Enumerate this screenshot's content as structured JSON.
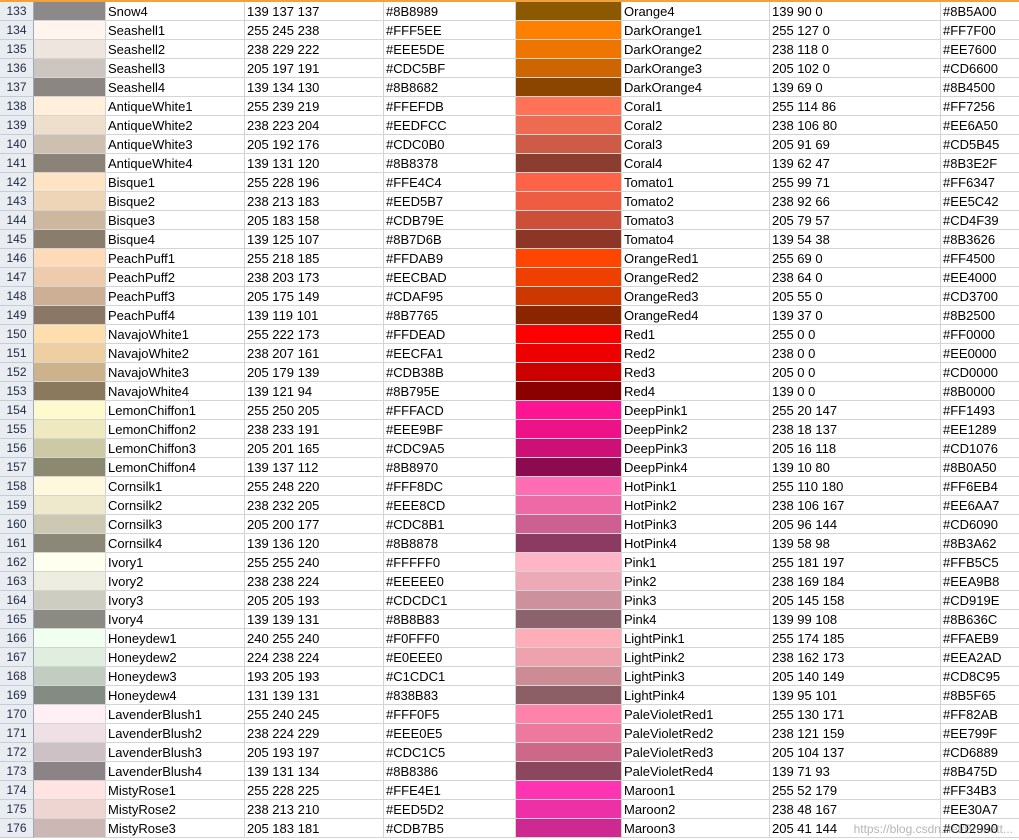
{
  "rows": [
    {
      "num": "133",
      "name1": "Snow4",
      "rgb1": "139 137 137",
      "hex1": "#8B8989",
      "name2": "Orange4",
      "rgb2": "139 90 0",
      "hex2": "#8B5A00"
    },
    {
      "num": "134",
      "name1": "Seashell1",
      "rgb1": "255 245 238",
      "hex1": "#FFF5EE",
      "name2": "DarkOrange1",
      "rgb2": "255 127 0",
      "hex2": "#FF7F00"
    },
    {
      "num": "135",
      "name1": "Seashell2",
      "rgb1": "238 229 222",
      "hex1": "#EEE5DE",
      "name2": "DarkOrange2",
      "rgb2": "238 118 0",
      "hex2": "#EE7600"
    },
    {
      "num": "136",
      "name1": "Seashell3",
      "rgb1": "205 197 191",
      "hex1": "#CDC5BF",
      "name2": "DarkOrange3",
      "rgb2": "205 102 0",
      "hex2": "#CD6600"
    },
    {
      "num": "137",
      "name1": "Seashell4",
      "rgb1": "139 134 130",
      "hex1": "#8B8682",
      "name2": "DarkOrange4",
      "rgb2": "139 69 0",
      "hex2": "#8B4500"
    },
    {
      "num": "138",
      "name1": "AntiqueWhite1",
      "rgb1": "255 239 219",
      "hex1": "#FFEFDB",
      "name2": "Coral1",
      "rgb2": "255 114 86",
      "hex2": "#FF7256"
    },
    {
      "num": "139",
      "name1": "AntiqueWhite2",
      "rgb1": "238 223 204",
      "hex1": "#EEDFCC",
      "name2": "Coral2",
      "rgb2": "238 106 80",
      "hex2": "#EE6A50"
    },
    {
      "num": "140",
      "name1": "AntiqueWhite3",
      "rgb1": "205 192 176",
      "hex1": "#CDC0B0",
      "name2": "Coral3",
      "rgb2": "205 91 69",
      "hex2": "#CD5B45"
    },
    {
      "num": "141",
      "name1": "AntiqueWhite4",
      "rgb1": "139 131 120",
      "hex1": "#8B8378",
      "name2": "Coral4",
      "rgb2": "139 62 47",
      "hex2": "#8B3E2F"
    },
    {
      "num": "142",
      "name1": "Bisque1",
      "rgb1": "255 228 196",
      "hex1": "#FFE4C4",
      "name2": "Tomato1",
      "rgb2": "255 99 71",
      "hex2": "#FF6347"
    },
    {
      "num": "143",
      "name1": "Bisque2",
      "rgb1": "238 213 183",
      "hex1": "#EED5B7",
      "name2": "Tomato2",
      "rgb2": "238 92 66",
      "hex2": "#EE5C42"
    },
    {
      "num": "144",
      "name1": "Bisque3",
      "rgb1": "205 183 158",
      "hex1": "#CDB79E",
      "name2": "Tomato3",
      "rgb2": "205 79 57",
      "hex2": "#CD4F39"
    },
    {
      "num": "145",
      "name1": "Bisque4",
      "rgb1": "139 125 107",
      "hex1": "#8B7D6B",
      "name2": "Tomato4",
      "rgb2": "139 54 38",
      "hex2": "#8B3626"
    },
    {
      "num": "146",
      "name1": "PeachPuff1",
      "rgb1": "255 218 185",
      "hex1": "#FFDAB9",
      "name2": "OrangeRed1",
      "rgb2": "255 69 0",
      "hex2": "#FF4500"
    },
    {
      "num": "147",
      "name1": "PeachPuff2",
      "rgb1": "238 203 173",
      "hex1": "#EECBAD",
      "name2": "OrangeRed2",
      "rgb2": "238 64 0",
      "hex2": "#EE4000"
    },
    {
      "num": "148",
      "name1": "PeachPuff3",
      "rgb1": "205 175 149",
      "hex1": "#CDAF95",
      "name2": "OrangeRed3",
      "rgb2": "205 55 0",
      "hex2": "#CD3700"
    },
    {
      "num": "149",
      "name1": "PeachPuff4",
      "rgb1": "139 119 101",
      "hex1": "#8B7765",
      "name2": "OrangeRed4",
      "rgb2": "139 37 0",
      "hex2": "#8B2500"
    },
    {
      "num": "150",
      "name1": "NavajoWhite1",
      "rgb1": "255 222 173",
      "hex1": "#FFDEAD",
      "name2": "Red1",
      "rgb2": "255 0 0",
      "hex2": "#FF0000"
    },
    {
      "num": "151",
      "name1": "NavajoWhite2",
      "rgb1": "238 207 161",
      "hex1": "#EECFA1",
      "name2": "Red2",
      "rgb2": "238 0 0",
      "hex2": "#EE0000"
    },
    {
      "num": "152",
      "name1": "NavajoWhite3",
      "rgb1": "205 179 139",
      "hex1": "#CDB38B",
      "name2": "Red3",
      "rgb2": "205 0 0",
      "hex2": "#CD0000"
    },
    {
      "num": "153",
      "name1": "NavajoWhite4",
      "rgb1": "139 121 94",
      "hex1": "#8B795E",
      "name2": "Red4",
      "rgb2": "139 0 0",
      "hex2": "#8B0000"
    },
    {
      "num": "154",
      "name1": "LemonChiffon1",
      "rgb1": "255 250 205",
      "hex1": "#FFFACD",
      "name2": "DeepPink1",
      "rgb2": "255 20 147",
      "hex2": "#FF1493"
    },
    {
      "num": "155",
      "name1": "LemonChiffon2",
      "rgb1": "238 233 191",
      "hex1": "#EEE9BF",
      "name2": "DeepPink2",
      "rgb2": "238 18 137",
      "hex2": "#EE1289"
    },
    {
      "num": "156",
      "name1": "LemonChiffon3",
      "rgb1": "205 201 165",
      "hex1": "#CDC9A5",
      "name2": "DeepPink3",
      "rgb2": "205 16 118",
      "hex2": "#CD1076"
    },
    {
      "num": "157",
      "name1": "LemonChiffon4",
      "rgb1": "139 137 112",
      "hex1": "#8B8970",
      "name2": "DeepPink4",
      "rgb2": "139 10 80",
      "hex2": "#8B0A50"
    },
    {
      "num": "158",
      "name1": "Cornsilk1",
      "rgb1": "255 248 220",
      "hex1": "#FFF8DC",
      "name2": "HotPink1",
      "rgb2": "255 110 180",
      "hex2": "#FF6EB4"
    },
    {
      "num": "159",
      "name1": "Cornsilk2",
      "rgb1": "238 232 205",
      "hex1": "#EEE8CD",
      "name2": "HotPink2",
      "rgb2": "238 106 167",
      "hex2": "#EE6AA7"
    },
    {
      "num": "160",
      "name1": "Cornsilk3",
      "rgb1": "205 200 177",
      "hex1": "#CDC8B1",
      "name2": "HotPink3",
      "rgb2": "205 96 144",
      "hex2": "#CD6090"
    },
    {
      "num": "161",
      "name1": "Cornsilk4",
      "rgb1": "139 136 120",
      "hex1": "#8B8878",
      "name2": "HotPink4",
      "rgb2": "139 58 98",
      "hex2": "#8B3A62"
    },
    {
      "num": "162",
      "name1": "Ivory1",
      "rgb1": "255 255 240",
      "hex1": "#FFFFF0",
      "name2": "Pink1",
      "rgb2": "255 181 197",
      "hex2": "#FFB5C5"
    },
    {
      "num": "163",
      "name1": "Ivory2",
      "rgb1": "238 238 224",
      "hex1": "#EEEEE0",
      "name2": "Pink2",
      "rgb2": "238 169 184",
      "hex2": "#EEA9B8"
    },
    {
      "num": "164",
      "name1": "Ivory3",
      "rgb1": "205 205 193",
      "hex1": "#CDCDC1",
      "name2": "Pink3",
      "rgb2": "205 145 158",
      "hex2": "#CD919E"
    },
    {
      "num": "165",
      "name1": "Ivory4",
      "rgb1": "139 139 131",
      "hex1": "#8B8B83",
      "name2": "Pink4",
      "rgb2": "139 99 108",
      "hex2": "#8B636C"
    },
    {
      "num": "166",
      "name1": "Honeydew1",
      "rgb1": "240 255 240",
      "hex1": "#F0FFF0",
      "name2": "LightPink1",
      "rgb2": "255 174 185",
      "hex2": "#FFAEB9"
    },
    {
      "num": "167",
      "name1": "Honeydew2",
      "rgb1": "224 238 224",
      "hex1": "#E0EEE0",
      "name2": "LightPink2",
      "rgb2": "238 162 173",
      "hex2": "#EEA2AD"
    },
    {
      "num": "168",
      "name1": "Honeydew3",
      "rgb1": "193 205 193",
      "hex1": "#C1CDC1",
      "name2": "LightPink3",
      "rgb2": "205 140 149",
      "hex2": "#CD8C95"
    },
    {
      "num": "169",
      "name1": "Honeydew4",
      "rgb1": "131 139 131",
      "hex1": "#838B83",
      "name2": "LightPink4",
      "rgb2": "139 95 101",
      "hex2": "#8B5F65"
    },
    {
      "num": "170",
      "name1": "LavenderBlush1",
      "rgb1": "255 240 245",
      "hex1": "#FFF0F5",
      "name2": "PaleVioletRed1",
      "rgb2": "255 130 171",
      "hex2": "#FF82AB"
    },
    {
      "num": "171",
      "name1": "LavenderBlush2",
      "rgb1": "238 224 229",
      "hex1": "#EEE0E5",
      "name2": "PaleVioletRed2",
      "rgb2": "238 121 159",
      "hex2": "#EE799F"
    },
    {
      "num": "172",
      "name1": "LavenderBlush3",
      "rgb1": "205 193 197",
      "hex1": "#CDC1C5",
      "name2": "PaleVioletRed3",
      "rgb2": "205 104 137",
      "hex2": "#CD6889"
    },
    {
      "num": "173",
      "name1": "LavenderBlush4",
      "rgb1": "139 131 134",
      "hex1": "#8B8386",
      "name2": "PaleVioletRed4",
      "rgb2": "139 71 93",
      "hex2": "#8B475D"
    },
    {
      "num": "174",
      "name1": "MistyRose1",
      "rgb1": "255 228 225",
      "hex1": "#FFE4E1",
      "name2": "Maroon1",
      "rgb2": "255 52 179",
      "hex2": "#FF34B3"
    },
    {
      "num": "175",
      "name1": "MistyRose2",
      "rgb1": "238 213 210",
      "hex1": "#EED5D2",
      "name2": "Maroon2",
      "rgb2": "238 48 167",
      "hex2": "#EE30A7"
    },
    {
      "num": "176",
      "name1": "MistyRose3",
      "rgb1": "205 183 181",
      "hex1": "#CDB7B5",
      "name2": "Maroon3",
      "rgb2": "205 41 144",
      "hex2": "#CD2990"
    }
  ],
  "watermark": "https://blog.csdn.net/Brunett..."
}
